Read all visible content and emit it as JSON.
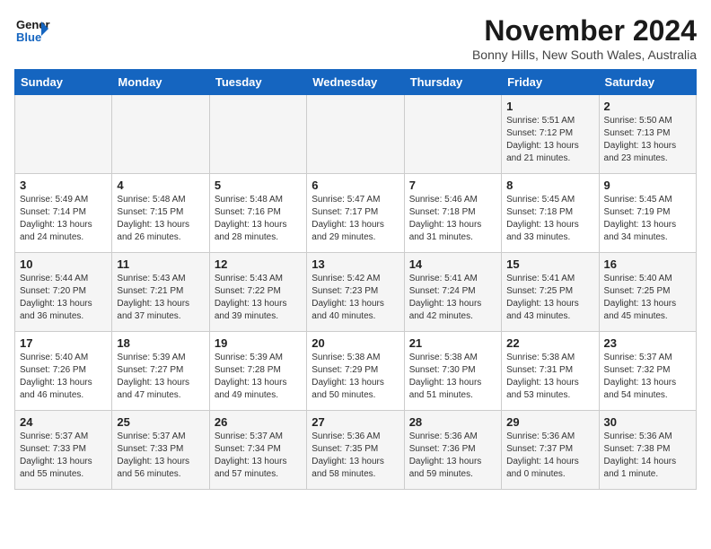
{
  "logo": {
    "line1": "General",
    "line2": "Blue"
  },
  "title": "November 2024",
  "location": "Bonny Hills, New South Wales, Australia",
  "weekdays": [
    "Sunday",
    "Monday",
    "Tuesday",
    "Wednesday",
    "Thursday",
    "Friday",
    "Saturday"
  ],
  "weeks": [
    [
      {
        "day": "",
        "info": ""
      },
      {
        "day": "",
        "info": ""
      },
      {
        "day": "",
        "info": ""
      },
      {
        "day": "",
        "info": ""
      },
      {
        "day": "",
        "info": ""
      },
      {
        "day": "1",
        "info": "Sunrise: 5:51 AM\nSunset: 7:12 PM\nDaylight: 13 hours and 21 minutes."
      },
      {
        "day": "2",
        "info": "Sunrise: 5:50 AM\nSunset: 7:13 PM\nDaylight: 13 hours and 23 minutes."
      }
    ],
    [
      {
        "day": "3",
        "info": "Sunrise: 5:49 AM\nSunset: 7:14 PM\nDaylight: 13 hours and 24 minutes."
      },
      {
        "day": "4",
        "info": "Sunrise: 5:48 AM\nSunset: 7:15 PM\nDaylight: 13 hours and 26 minutes."
      },
      {
        "day": "5",
        "info": "Sunrise: 5:48 AM\nSunset: 7:16 PM\nDaylight: 13 hours and 28 minutes."
      },
      {
        "day": "6",
        "info": "Sunrise: 5:47 AM\nSunset: 7:17 PM\nDaylight: 13 hours and 29 minutes."
      },
      {
        "day": "7",
        "info": "Sunrise: 5:46 AM\nSunset: 7:18 PM\nDaylight: 13 hours and 31 minutes."
      },
      {
        "day": "8",
        "info": "Sunrise: 5:45 AM\nSunset: 7:18 PM\nDaylight: 13 hours and 33 minutes."
      },
      {
        "day": "9",
        "info": "Sunrise: 5:45 AM\nSunset: 7:19 PM\nDaylight: 13 hours and 34 minutes."
      }
    ],
    [
      {
        "day": "10",
        "info": "Sunrise: 5:44 AM\nSunset: 7:20 PM\nDaylight: 13 hours and 36 minutes."
      },
      {
        "day": "11",
        "info": "Sunrise: 5:43 AM\nSunset: 7:21 PM\nDaylight: 13 hours and 37 minutes."
      },
      {
        "day": "12",
        "info": "Sunrise: 5:43 AM\nSunset: 7:22 PM\nDaylight: 13 hours and 39 minutes."
      },
      {
        "day": "13",
        "info": "Sunrise: 5:42 AM\nSunset: 7:23 PM\nDaylight: 13 hours and 40 minutes."
      },
      {
        "day": "14",
        "info": "Sunrise: 5:41 AM\nSunset: 7:24 PM\nDaylight: 13 hours and 42 minutes."
      },
      {
        "day": "15",
        "info": "Sunrise: 5:41 AM\nSunset: 7:25 PM\nDaylight: 13 hours and 43 minutes."
      },
      {
        "day": "16",
        "info": "Sunrise: 5:40 AM\nSunset: 7:25 PM\nDaylight: 13 hours and 45 minutes."
      }
    ],
    [
      {
        "day": "17",
        "info": "Sunrise: 5:40 AM\nSunset: 7:26 PM\nDaylight: 13 hours and 46 minutes."
      },
      {
        "day": "18",
        "info": "Sunrise: 5:39 AM\nSunset: 7:27 PM\nDaylight: 13 hours and 47 minutes."
      },
      {
        "day": "19",
        "info": "Sunrise: 5:39 AM\nSunset: 7:28 PM\nDaylight: 13 hours and 49 minutes."
      },
      {
        "day": "20",
        "info": "Sunrise: 5:38 AM\nSunset: 7:29 PM\nDaylight: 13 hours and 50 minutes."
      },
      {
        "day": "21",
        "info": "Sunrise: 5:38 AM\nSunset: 7:30 PM\nDaylight: 13 hours and 51 minutes."
      },
      {
        "day": "22",
        "info": "Sunrise: 5:38 AM\nSunset: 7:31 PM\nDaylight: 13 hours and 53 minutes."
      },
      {
        "day": "23",
        "info": "Sunrise: 5:37 AM\nSunset: 7:32 PM\nDaylight: 13 hours and 54 minutes."
      }
    ],
    [
      {
        "day": "24",
        "info": "Sunrise: 5:37 AM\nSunset: 7:33 PM\nDaylight: 13 hours and 55 minutes."
      },
      {
        "day": "25",
        "info": "Sunrise: 5:37 AM\nSunset: 7:33 PM\nDaylight: 13 hours and 56 minutes."
      },
      {
        "day": "26",
        "info": "Sunrise: 5:37 AM\nSunset: 7:34 PM\nDaylight: 13 hours and 57 minutes."
      },
      {
        "day": "27",
        "info": "Sunrise: 5:36 AM\nSunset: 7:35 PM\nDaylight: 13 hours and 58 minutes."
      },
      {
        "day": "28",
        "info": "Sunrise: 5:36 AM\nSunset: 7:36 PM\nDaylight: 13 hours and 59 minutes."
      },
      {
        "day": "29",
        "info": "Sunrise: 5:36 AM\nSunset: 7:37 PM\nDaylight: 14 hours and 0 minutes."
      },
      {
        "day": "30",
        "info": "Sunrise: 5:36 AM\nSunset: 7:38 PM\nDaylight: 14 hours and 1 minute."
      }
    ]
  ]
}
